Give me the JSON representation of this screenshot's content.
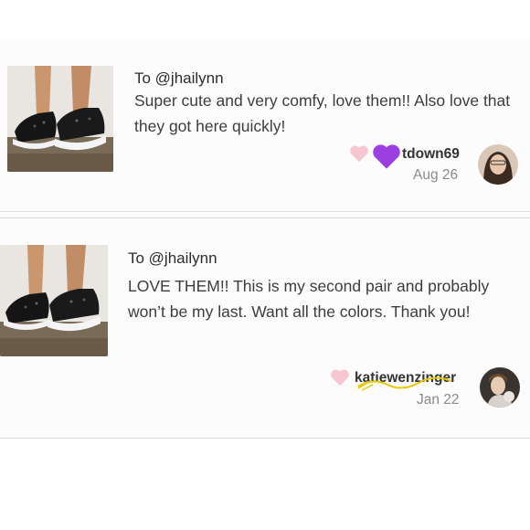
{
  "reviews": [
    {
      "to": "To @jhailynn",
      "message": "Super cute and very comfy, love them!! Also love that they got here quickly!",
      "username": "tdown69",
      "date": "Aug 26",
      "icons": [
        "heart-pink-icon",
        "heart-purple-icon"
      ]
    },
    {
      "to": "To @jhailynn",
      "message": "LOVE THEM!! This is my second pair and probably won’t be my last. Want all the colors. Thank you!",
      "username": "katiewenzinger",
      "date": "Jan 22",
      "icons": [
        "heart-pink-icon"
      ]
    }
  ],
  "colors": {
    "pink_heart": "#f7c6d0",
    "purple_heart": "#9b3fe0",
    "date_text": "#8a8a8a",
    "scribble": "#e8c800"
  }
}
